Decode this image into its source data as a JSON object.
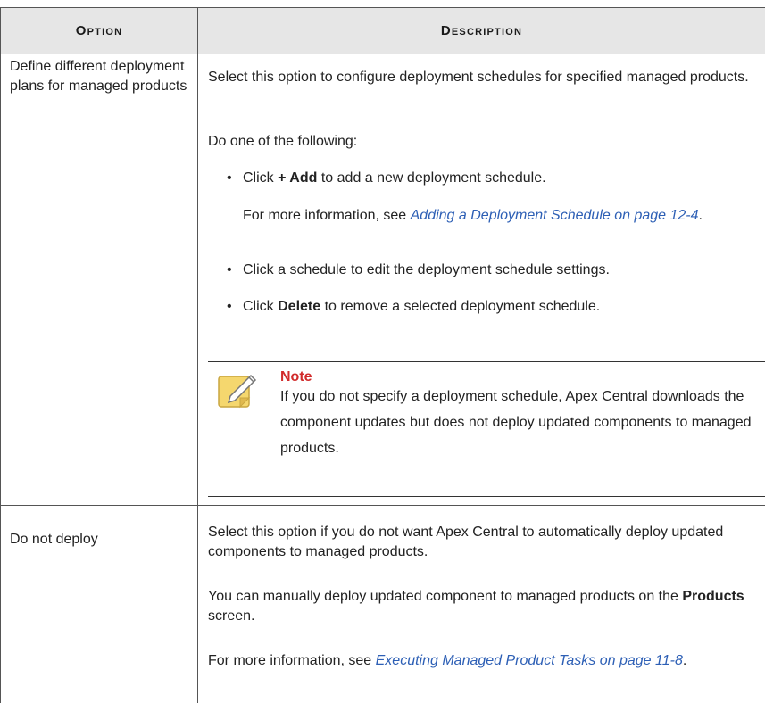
{
  "header": {
    "option": "Option",
    "description": "Description"
  },
  "rows": [
    {
      "option": "Define different deployment plans for managed products",
      "desc_intro": "Select this option to configure deployment schedules for specified managed products.",
      "do_one": "Do one of the following:",
      "bullet1": {
        "prefix": "Click ",
        "bold": "+ Add",
        "suffix": " to add a new deployment schedule."
      },
      "more_info": {
        "prefix": "For more information, see ",
        "link": "Adding a Deployment Schedule on page 12-4",
        "suffix": "."
      },
      "bullet2": "Click a schedule to edit the deployment schedule settings.",
      "bullet3": {
        "prefix": "Click ",
        "bold": "Delete",
        "suffix": " to remove a selected deployment schedule."
      },
      "note": {
        "title": "Note",
        "text": "If you do not specify a deployment schedule, Apex Central downloads the component updates but does not deploy updated components to managed products."
      }
    },
    {
      "option": "Do not deploy",
      "desc_intro": "Select this option if you do not want Apex Central to automatically deploy updated components to managed products.",
      "manual": {
        "prefix": "You can manually deploy updated component to managed products on the ",
        "bold": "Products",
        "suffix": " screen."
      },
      "more_info": {
        "prefix": "For more information, see ",
        "link": "Executing Managed Product Tasks on page 11-8",
        "suffix": "."
      }
    }
  ],
  "colors": {
    "header_bg": "#e6e6e6",
    "link": "#2d5fb5",
    "note_title": "#d12b2b",
    "note_icon": "#f5d76e"
  },
  "icons": {
    "note": "note-pencil-icon"
  }
}
